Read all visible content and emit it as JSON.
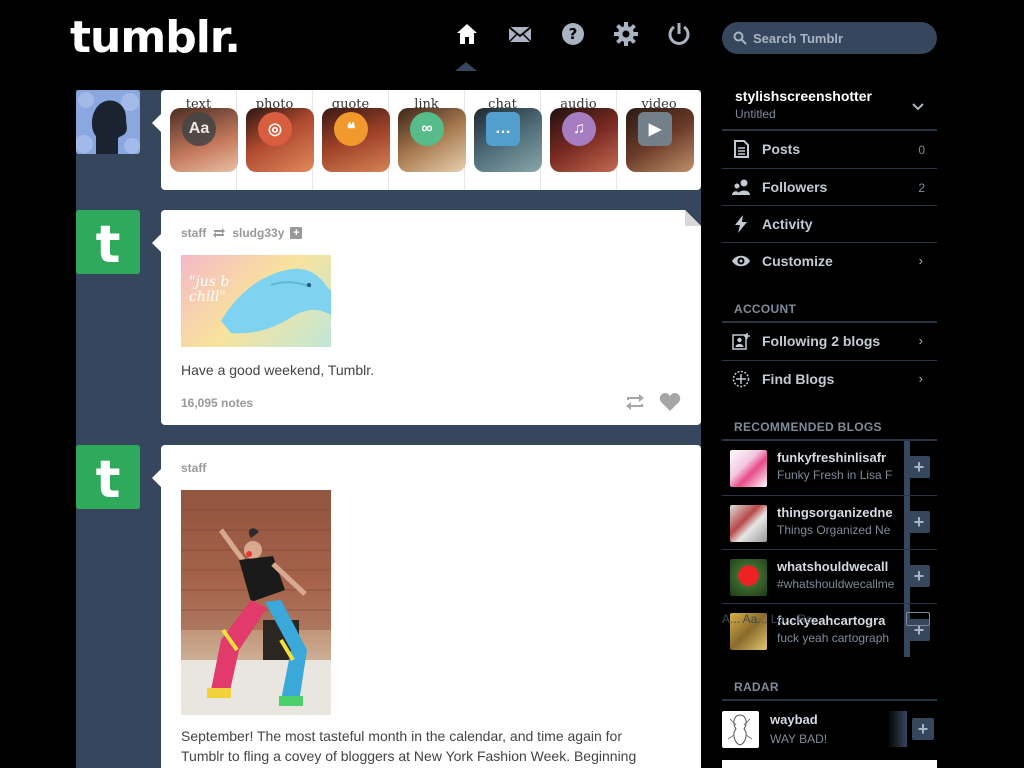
{
  "header": {
    "logo": "tumblr.",
    "nav": [
      {
        "name": "home-icon",
        "active": true
      },
      {
        "name": "mail-icon"
      },
      {
        "name": "help-icon"
      },
      {
        "name": "settings-icon"
      },
      {
        "name": "power-icon"
      }
    ],
    "search_placeholder": "Search Tumblr"
  },
  "compose": {
    "types": [
      {
        "label": "text",
        "glyph": "Aa",
        "color": "#444444"
      },
      {
        "label": "photo",
        "glyph": "◎",
        "color": "#d95e40"
      },
      {
        "label": "quote",
        "glyph": "❝",
        "color": "#f2992e"
      },
      {
        "label": "link",
        "glyph": "∞",
        "color": "#56bc8a"
      },
      {
        "label": "chat",
        "glyph": "…",
        "color": "#529ecc"
      },
      {
        "label": "audio",
        "glyph": "♫",
        "color": "#a77dc2"
      },
      {
        "label": "video",
        "glyph": "▶",
        "color": "#748089"
      }
    ]
  },
  "posts": [
    {
      "author": "staff",
      "reblogged_from": "sludg33y",
      "image_text": "\"jus b chill\"",
      "body": "Have a good weekend, Tumblr.",
      "notes": "16,095 notes"
    },
    {
      "author": "staff",
      "body_lines": [
        "September! The most tasteful month in the calendar, and time again for",
        "Tumblr to fling a covey of bloggers at New York Fashion Week. Beginning"
      ]
    }
  ],
  "sidebar": {
    "blog_name": "stylishscreenshotter",
    "blog_subtitle": "Untitled",
    "rows": [
      {
        "label": "Posts",
        "count": "0"
      },
      {
        "label": "Followers",
        "count": "2"
      },
      {
        "label": "Activity",
        "count": ""
      },
      {
        "label": "Customize",
        "count": ""
      }
    ],
    "account_heading": "ACCOUNT",
    "account_rows": [
      {
        "label": "Following 2 blogs"
      },
      {
        "label": "Find Blogs"
      }
    ],
    "recommended_heading": "RECOMMENDED BLOGS",
    "recommended": [
      {
        "name": "funkyfreshinlisafr",
        "desc": "Funky Fresh in Lisa F"
      },
      {
        "name": "thingsorganizedne",
        "desc": "Things Organized Ne"
      },
      {
        "name": "whatshouldwecall",
        "desc": "#whatshouldwecallme"
      },
      {
        "name": "fuckyeahcartogra",
        "desc": "fuck yeah cartograph"
      }
    ],
    "radar_heading": "RADAR",
    "radar": {
      "name": "waybad",
      "desc": "WAY BAD!"
    }
  },
  "osk": {
    "text": "A... Aa... Lo... Ra..."
  }
}
